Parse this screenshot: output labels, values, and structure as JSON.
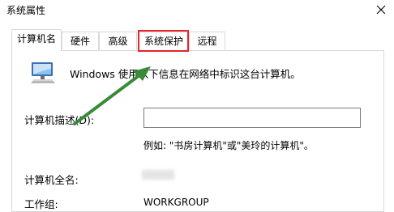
{
  "window": {
    "title": "系统属性"
  },
  "tabs": [
    {
      "label": "计算机名"
    },
    {
      "label": "硬件"
    },
    {
      "label": "高级"
    },
    {
      "label": "系统保护"
    },
    {
      "label": "远程"
    }
  ],
  "computer_name_page": {
    "description": "Windows 使用以下信息在网络中标识这台计算机。",
    "computer_description_label": "计算机描述(D):",
    "computer_description_value": "",
    "example_text": "例如: \"书房计算机\"或\"美玲的计算机\"。",
    "full_name_label": "计算机全名:",
    "workgroup_label": "工作组:",
    "workgroup_value": "WORKGROUP"
  },
  "annotation": {
    "highlight_color": "#e8242d",
    "arrow_color": "#3a8a3a"
  }
}
